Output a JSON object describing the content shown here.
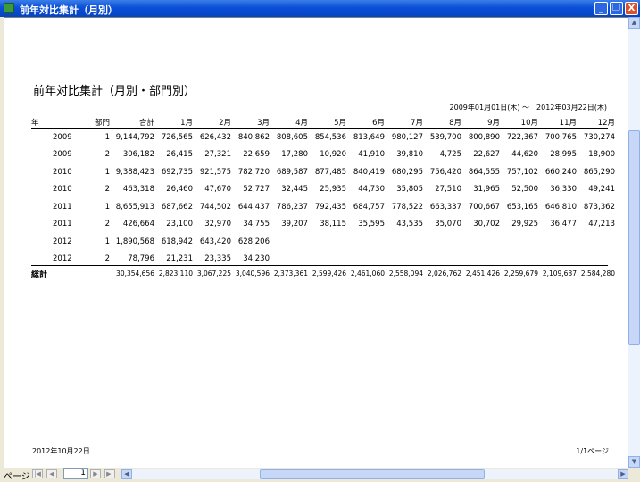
{
  "window": {
    "title": "前年対比集計（月別）",
    "minimize": "_",
    "restore": "❐",
    "close": "X"
  },
  "report": {
    "title": "前年対比集計（月別・部門別）",
    "date_range": "2009年01月01日(木) ～　2012年03月22日(木)",
    "columns": [
      "年",
      "部門",
      "合計",
      "1月",
      "2月",
      "3月",
      "4月",
      "5月",
      "6月",
      "7月",
      "8月",
      "9月",
      "10月",
      "11月",
      "12月"
    ],
    "rows": [
      [
        "2009",
        "1",
        "9,144,792",
        "726,565",
        "626,432",
        "840,862",
        "808,605",
        "854,536",
        "813,649",
        "980,127",
        "539,700",
        "800,890",
        "722,367",
        "700,765",
        "730,274"
      ],
      [
        "2009",
        "2",
        "306,182",
        "26,415",
        "27,321",
        "22,659",
        "17,280",
        "10,920",
        "41,910",
        "39,810",
        "4,725",
        "22,627",
        "44,620",
        "28,995",
        "18,900"
      ],
      [
        "2010",
        "1",
        "9,388,423",
        "692,735",
        "921,575",
        "782,720",
        "689,587",
        "877,485",
        "840,419",
        "680,295",
        "756,420",
        "864,555",
        "757,102",
        "660,240",
        "865,290"
      ],
      [
        "2010",
        "2",
        "463,318",
        "26,460",
        "47,670",
        "52,727",
        "32,445",
        "25,935",
        "44,730",
        "35,805",
        "27,510",
        "31,965",
        "52,500",
        "36,330",
        "49,241"
      ],
      [
        "2011",
        "1",
        "8,655,913",
        "687,662",
        "744,502",
        "644,437",
        "786,237",
        "792,435",
        "684,757",
        "778,522",
        "663,337",
        "700,667",
        "653,165",
        "646,810",
        "873,362"
      ],
      [
        "2011",
        "2",
        "426,664",
        "23,100",
        "32,970",
        "34,755",
        "39,207",
        "38,115",
        "35,595",
        "43,535",
        "35,070",
        "30,702",
        "29,925",
        "36,477",
        "47,213"
      ],
      [
        "2012",
        "1",
        "1,890,568",
        "618,942",
        "643,420",
        "628,206",
        "",
        "",
        "",
        "",
        "",
        "",
        "",
        "",
        ""
      ],
      [
        "2012",
        "2",
        "78,796",
        "21,231",
        "23,335",
        "34,230",
        "",
        "",
        "",
        "",
        "",
        "",
        "",
        "",
        ""
      ]
    ],
    "total": {
      "label": "総計",
      "values": [
        "30,354,656",
        "2,823,110",
        "3,067,225",
        "3,040,596",
        "2,373,361",
        "2,599,426",
        "2,461,060",
        "2,558,094",
        "2,026,762",
        "2,451,426",
        "2,259,679",
        "2,109,637",
        "2,584,280"
      ]
    },
    "footer_date": "2012年10月22日",
    "footer_page": "1/1ページ"
  },
  "navigation": {
    "page_label": "ページ",
    "current_page": "1"
  },
  "colors": {
    "titlebar": "#0a4fd6",
    "close_button": "#d9542e"
  }
}
